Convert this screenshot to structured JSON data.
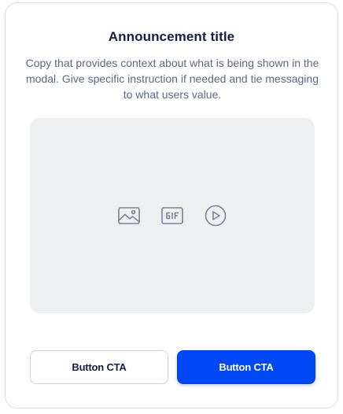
{
  "modal": {
    "title": "Announcement title",
    "copy": "Copy that provides context about what is being shown in the modal. Give specific instruction if needed and tie messaging to what users value.",
    "media": {
      "icons": [
        "image-icon",
        "gif-icon",
        "play-icon"
      ]
    },
    "buttons": {
      "secondary_label": "Button CTA",
      "primary_label": "Button CTA"
    }
  },
  "colors": {
    "primary": "#0047f5",
    "title": "#0f1e4a",
    "body_text": "#5a6889",
    "media_bg": "#eeeff1",
    "icon": "#7a8396"
  }
}
